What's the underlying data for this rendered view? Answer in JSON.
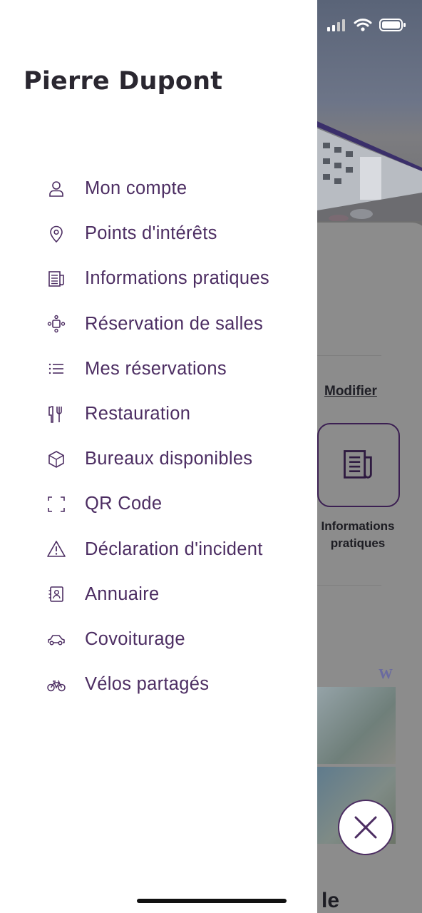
{
  "colors": {
    "accent": "#4c2d62",
    "drawer_bg": "#ffffff",
    "overlay": "#808080"
  },
  "status_bar": {
    "icons": [
      "signal-icon",
      "wifi-icon",
      "battery-icon"
    ]
  },
  "drawer": {
    "user_name": "Pierre Dupont",
    "items": [
      {
        "label": "Mon compte",
        "icon": "user-icon"
      },
      {
        "label": "Points d'intérêts",
        "icon": "map-pin-icon"
      },
      {
        "label": "Informations pratiques",
        "icon": "newspaper-icon"
      },
      {
        "label": "Réservation de salles",
        "icon": "meeting-room-icon"
      },
      {
        "label": "Mes réservations",
        "icon": "list-icon"
      },
      {
        "label": "Restauration",
        "icon": "restaurant-icon"
      },
      {
        "label": "Bureaux disponibles",
        "icon": "cube-icon"
      },
      {
        "label": "QR Code",
        "icon": "qr-scan-icon"
      },
      {
        "label": "Déclaration d'incident",
        "icon": "warning-icon"
      },
      {
        "label": "Annuaire",
        "icon": "contacts-book-icon"
      },
      {
        "label": "Covoiturage",
        "icon": "car-icon"
      },
      {
        "label": "Vélos partagés",
        "icon": "bicycle-icon"
      }
    ]
  },
  "background": {
    "modify_link": "Modifier",
    "tile_label": "Informations pratiques",
    "bottom_text": "le"
  }
}
